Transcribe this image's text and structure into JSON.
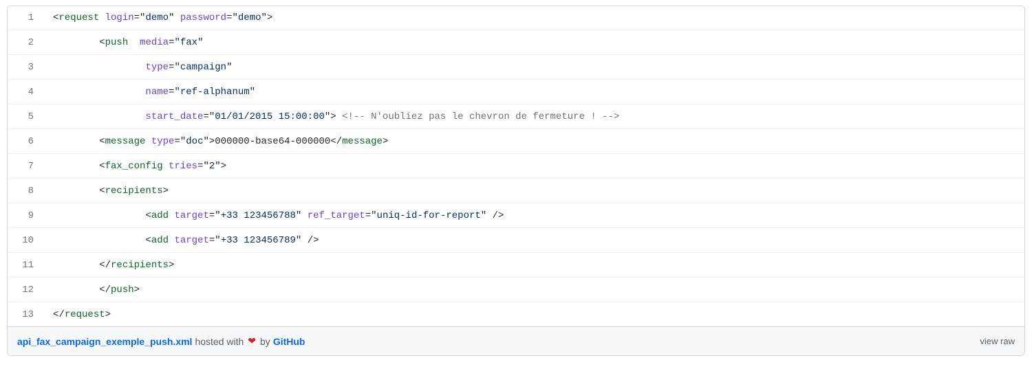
{
  "lines": [
    {
      "n": "1",
      "segments": [
        {
          "cls": "punct",
          "t": "<"
        },
        {
          "cls": "tag",
          "t": "request"
        },
        {
          "cls": "txt",
          "t": " "
        },
        {
          "cls": "attr",
          "t": "login"
        },
        {
          "cls": "punct",
          "t": "="
        },
        {
          "cls": "punct",
          "t": "\""
        },
        {
          "cls": "val",
          "t": "demo"
        },
        {
          "cls": "punct",
          "t": "\""
        },
        {
          "cls": "txt",
          "t": " "
        },
        {
          "cls": "attr",
          "t": "password"
        },
        {
          "cls": "punct",
          "t": "="
        },
        {
          "cls": "punct",
          "t": "\""
        },
        {
          "cls": "val",
          "t": "demo"
        },
        {
          "cls": "punct",
          "t": "\""
        },
        {
          "cls": "punct",
          "t": ">"
        }
      ]
    },
    {
      "n": "2",
      "segments": [
        {
          "cls": "txt",
          "t": "        "
        },
        {
          "cls": "punct",
          "t": "<"
        },
        {
          "cls": "tag",
          "t": "push"
        },
        {
          "cls": "txt",
          "t": "  "
        },
        {
          "cls": "attr",
          "t": "media"
        },
        {
          "cls": "punct",
          "t": "="
        },
        {
          "cls": "punct",
          "t": "\""
        },
        {
          "cls": "val",
          "t": "fax"
        },
        {
          "cls": "punct",
          "t": "\""
        }
      ]
    },
    {
      "n": "3",
      "segments": [
        {
          "cls": "txt",
          "t": "                "
        },
        {
          "cls": "attr",
          "t": "type"
        },
        {
          "cls": "punct",
          "t": "="
        },
        {
          "cls": "punct",
          "t": "\""
        },
        {
          "cls": "val",
          "t": "campaign"
        },
        {
          "cls": "punct",
          "t": "\""
        }
      ]
    },
    {
      "n": "4",
      "segments": [
        {
          "cls": "txt",
          "t": "                "
        },
        {
          "cls": "attr",
          "t": "name"
        },
        {
          "cls": "punct",
          "t": "="
        },
        {
          "cls": "punct",
          "t": "\""
        },
        {
          "cls": "val",
          "t": "ref-alphanum"
        },
        {
          "cls": "punct",
          "t": "\""
        }
      ]
    },
    {
      "n": "5",
      "segments": [
        {
          "cls": "txt",
          "t": "                "
        },
        {
          "cls": "attr",
          "t": "start_date"
        },
        {
          "cls": "punct",
          "t": "="
        },
        {
          "cls": "punct",
          "t": "\""
        },
        {
          "cls": "val",
          "t": "01/01/2015 15:00:00"
        },
        {
          "cls": "punct",
          "t": "\""
        },
        {
          "cls": "punct",
          "t": ">"
        },
        {
          "cls": "txt",
          "t": " "
        },
        {
          "cls": "cmt",
          "t": "<!-- N'oubliez pas le chevron de fermeture ! -->"
        }
      ]
    },
    {
      "n": "6",
      "segments": [
        {
          "cls": "txt",
          "t": "        "
        },
        {
          "cls": "punct",
          "t": "<"
        },
        {
          "cls": "tag",
          "t": "message"
        },
        {
          "cls": "txt",
          "t": " "
        },
        {
          "cls": "attr",
          "t": "type"
        },
        {
          "cls": "punct",
          "t": "="
        },
        {
          "cls": "punct",
          "t": "\""
        },
        {
          "cls": "val",
          "t": "doc"
        },
        {
          "cls": "punct",
          "t": "\""
        },
        {
          "cls": "punct",
          "t": ">"
        },
        {
          "cls": "txt",
          "t": "000000-base64-000000"
        },
        {
          "cls": "punct",
          "t": "</"
        },
        {
          "cls": "tag",
          "t": "message"
        },
        {
          "cls": "punct",
          "t": ">"
        }
      ]
    },
    {
      "n": "7",
      "segments": [
        {
          "cls": "txt",
          "t": "        "
        },
        {
          "cls": "punct",
          "t": "<"
        },
        {
          "cls": "tag",
          "t": "fax_config"
        },
        {
          "cls": "txt",
          "t": " "
        },
        {
          "cls": "attr",
          "t": "tries"
        },
        {
          "cls": "punct",
          "t": "="
        },
        {
          "cls": "punct",
          "t": "\""
        },
        {
          "cls": "val",
          "t": "2"
        },
        {
          "cls": "punct",
          "t": "\""
        },
        {
          "cls": "punct",
          "t": ">"
        }
      ]
    },
    {
      "n": "8",
      "segments": [
        {
          "cls": "txt",
          "t": "        "
        },
        {
          "cls": "punct",
          "t": "<"
        },
        {
          "cls": "tag",
          "t": "recipients"
        },
        {
          "cls": "punct",
          "t": ">"
        }
      ]
    },
    {
      "n": "9",
      "segments": [
        {
          "cls": "txt",
          "t": "                "
        },
        {
          "cls": "punct",
          "t": "<"
        },
        {
          "cls": "tag",
          "t": "add"
        },
        {
          "cls": "txt",
          "t": " "
        },
        {
          "cls": "attr",
          "t": "target"
        },
        {
          "cls": "punct",
          "t": "="
        },
        {
          "cls": "punct",
          "t": "\""
        },
        {
          "cls": "val",
          "t": "+33 123456788"
        },
        {
          "cls": "punct",
          "t": "\""
        },
        {
          "cls": "txt",
          "t": " "
        },
        {
          "cls": "attr",
          "t": "ref_target"
        },
        {
          "cls": "punct",
          "t": "="
        },
        {
          "cls": "punct",
          "t": "\""
        },
        {
          "cls": "val",
          "t": "uniq-id-for-report"
        },
        {
          "cls": "punct",
          "t": "\""
        },
        {
          "cls": "txt",
          "t": " "
        },
        {
          "cls": "punct",
          "t": "/>"
        }
      ]
    },
    {
      "n": "10",
      "segments": [
        {
          "cls": "txt",
          "t": "                "
        },
        {
          "cls": "punct",
          "t": "<"
        },
        {
          "cls": "tag",
          "t": "add"
        },
        {
          "cls": "txt",
          "t": " "
        },
        {
          "cls": "attr",
          "t": "target"
        },
        {
          "cls": "punct",
          "t": "="
        },
        {
          "cls": "punct",
          "t": "\""
        },
        {
          "cls": "val",
          "t": "+33 123456789"
        },
        {
          "cls": "punct",
          "t": "\""
        },
        {
          "cls": "txt",
          "t": " "
        },
        {
          "cls": "punct",
          "t": "/>"
        }
      ]
    },
    {
      "n": "11",
      "segments": [
        {
          "cls": "txt",
          "t": "        "
        },
        {
          "cls": "punct",
          "t": "</"
        },
        {
          "cls": "tag",
          "t": "recipients"
        },
        {
          "cls": "punct",
          "t": ">"
        }
      ]
    },
    {
      "n": "12",
      "segments": [
        {
          "cls": "txt",
          "t": "        "
        },
        {
          "cls": "punct",
          "t": "</"
        },
        {
          "cls": "tag",
          "t": "push"
        },
        {
          "cls": "punct",
          "t": ">"
        }
      ]
    },
    {
      "n": "13",
      "segments": [
        {
          "cls": "punct",
          "t": "</"
        },
        {
          "cls": "tag",
          "t": "request"
        },
        {
          "cls": "punct",
          "t": ">"
        }
      ]
    }
  ],
  "meta": {
    "filename": "api_fax_campaign_exemple_push.xml",
    "hosted_with": " hosted with ",
    "heart": "❤",
    "by": " by ",
    "github": "GitHub",
    "view_raw": "view raw"
  }
}
